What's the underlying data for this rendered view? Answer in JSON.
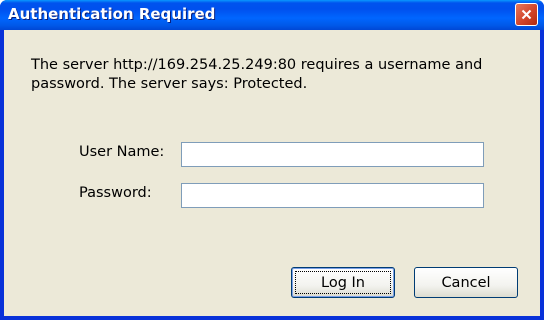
{
  "dialog": {
    "title": "Authentication Required",
    "message": "The server http://169.254.25.249:80 requires a username and password. The server says: Protected.",
    "close_icon": "close-x-icon"
  },
  "form": {
    "username_label": "User Name:",
    "username_value": "",
    "password_label": "Password:",
    "password_value": ""
  },
  "buttons": {
    "login_label": "Log In",
    "cancel_label": "Cancel"
  },
  "colors": {
    "titlebar": "#0054e3",
    "client": "#ece9d8",
    "close": "#d2452a"
  }
}
